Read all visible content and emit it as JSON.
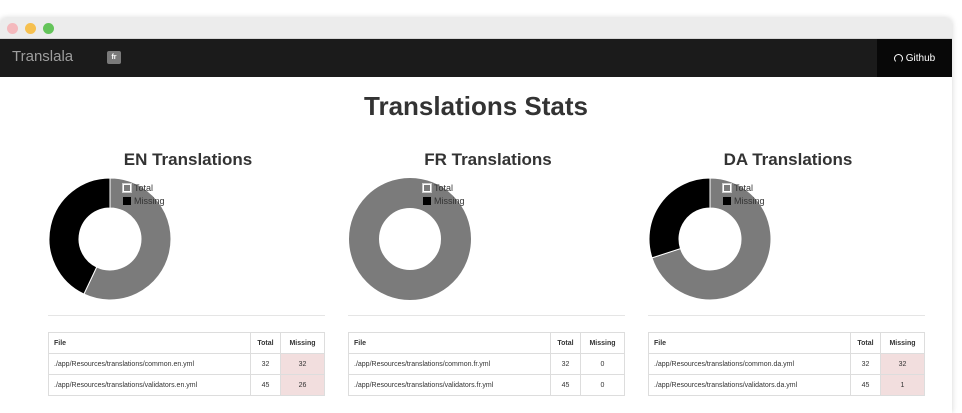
{
  "app": {
    "brand": "Translala",
    "language_badge": "fr",
    "github_label": "Github",
    "github_icon": "github-icon"
  },
  "page": {
    "title": "Translations Stats"
  },
  "colors": {
    "total": "#7b7b7b",
    "missing": "#000000",
    "missing_highlight": "#f2dede",
    "navbar": "#1b1b1b"
  },
  "panels": [
    {
      "title": "EN Translations",
      "legend": [
        "Total",
        "Missing"
      ],
      "chart_data": {
        "type": "pie",
        "labels": [
          "Total",
          "Missing"
        ],
        "values": [
          77,
          58
        ]
      },
      "table": {
        "headers": [
          "File",
          "Total",
          "Missing"
        ],
        "rows": [
          [
            "./app/Resources/translations/common.en.yml",
            "32",
            "32"
          ],
          [
            "./app/Resources/translations/validators.en.yml",
            "45",
            "26"
          ]
        ]
      }
    },
    {
      "title": "FR Translations",
      "legend": [
        "Total",
        "Missing"
      ],
      "chart_data": {
        "type": "pie",
        "labels": [
          "Total",
          "Missing"
        ],
        "values": [
          77,
          0
        ]
      },
      "table": {
        "headers": [
          "File",
          "Total",
          "Missing"
        ],
        "rows": [
          [
            "./app/Resources/translations/common.fr.yml",
            "32",
            "0"
          ],
          [
            "./app/Resources/translations/validators.fr.yml",
            "45",
            "0"
          ]
        ]
      }
    },
    {
      "title": "DA Translations",
      "legend": [
        "Total",
        "Missing"
      ],
      "chart_data": {
        "type": "pie",
        "labels": [
          "Total",
          "Missing"
        ],
        "values": [
          77,
          33
        ]
      },
      "table": {
        "headers": [
          "File",
          "Total",
          "Missing"
        ],
        "rows": [
          [
            "./app/Resources/translations/common.da.yml",
            "32",
            "32"
          ],
          [
            "./app/Resources/translations/validators.da.yml",
            "45",
            "1"
          ]
        ]
      }
    }
  ]
}
